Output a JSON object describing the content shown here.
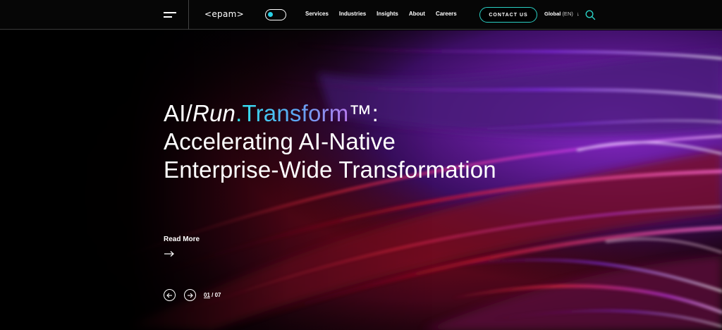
{
  "header": {
    "logo_text": "<epam>",
    "nav": [
      {
        "label": "Services"
      },
      {
        "label": "Industries"
      },
      {
        "label": "Insights"
      },
      {
        "label": "About"
      },
      {
        "label": "Careers"
      }
    ],
    "contact_label": "CONTACT US",
    "locale_region": "Global",
    "locale_lang": "(EN)",
    "icons": {
      "menu": "hamburger-icon",
      "search": "search-icon",
      "locale_arrow": "arrow-down-icon"
    }
  },
  "hero": {
    "headline": {
      "part_ai": "AI/",
      "part_run": "Run",
      "part_transform": ".Transform",
      "part_tm": "™:",
      "line2": "Accelerating AI-Native",
      "line3": "Enterprise-Wide Transformation"
    },
    "read_more_label": "Read More",
    "slider": {
      "current": "01",
      "separator": "/",
      "total": "07"
    }
  },
  "colors": {
    "accent_teal": "#2ad0c4",
    "accent_cyan": "#28d1e6",
    "gradient_purple": "#b87cf0",
    "background": "#000000"
  }
}
